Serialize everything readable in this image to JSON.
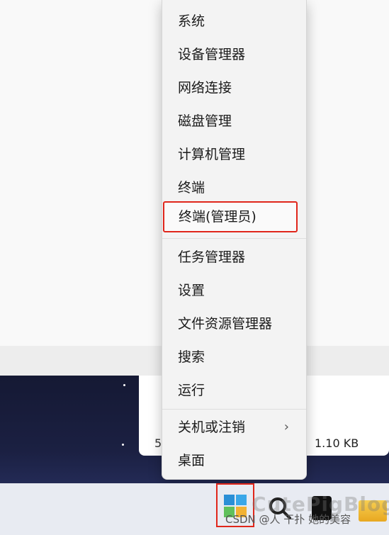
{
  "context_menu": {
    "items": [
      {
        "label": "系统"
      },
      {
        "label": "设备管理器"
      },
      {
        "label": "网络连接"
      },
      {
        "label": "磁盘管理"
      },
      {
        "label": "计算机管理"
      },
      {
        "label": "终端"
      },
      {
        "label": "终端(管理员)"
      },
      {
        "label": "任务管理器"
      },
      {
        "label": "设置"
      },
      {
        "label": "文件资源管理器"
      },
      {
        "label": "搜索"
      },
      {
        "label": "运行"
      },
      {
        "label": "关机或注销"
      },
      {
        "label": "桌面"
      }
    ],
    "submenu_icon": "chevron-right-icon",
    "highlight_color": "#e0261b"
  },
  "explorer_fragment": {
    "left_text": "5",
    "file_size": "1.10 KB"
  },
  "taskbar": {
    "start_icon": "windows-logo-icon",
    "search_icon": "search-icon",
    "folder_icon": "folder-icon"
  },
  "watermark": {
    "line1": "CutePigBlog",
    "line2": "CSDN @人 干扑 她的美容"
  }
}
